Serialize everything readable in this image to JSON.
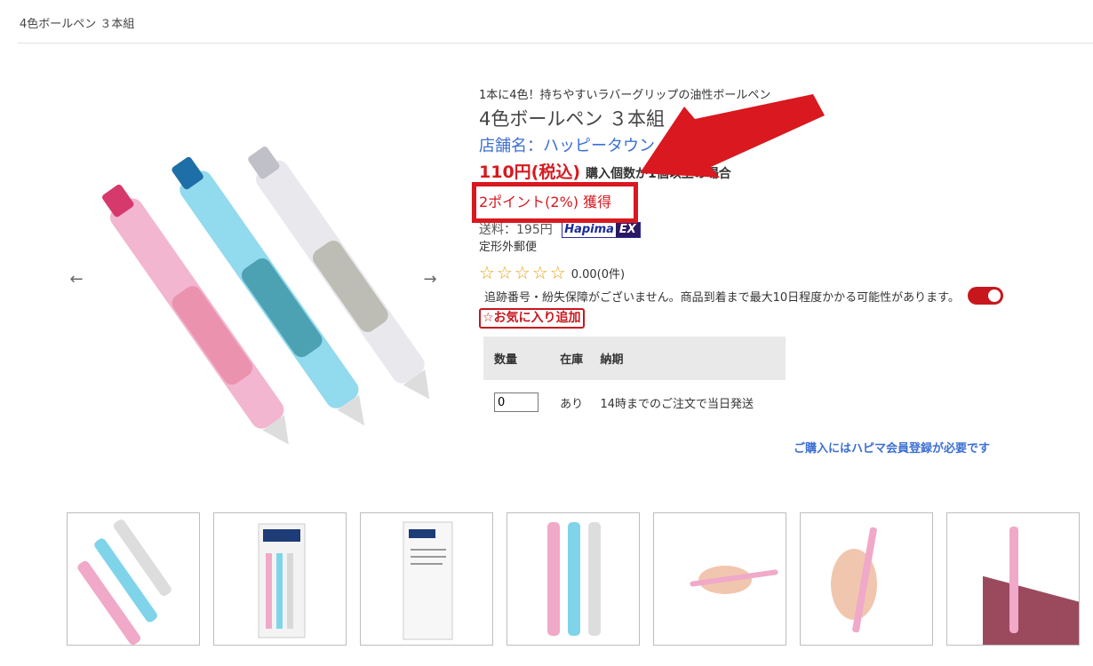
{
  "breadcrumb": "4色ボールペン ３本組",
  "product": {
    "subtitle": "1本に4色！持ちやすいラバーグリップの油性ボールペン",
    "title": "4色ボールペン ３本組",
    "shop": "店舗名：ハッピータウン",
    "price": "110円(税込)",
    "price_note": "購入個数が1個以上の場合",
    "points": "2ポイント(2%) 獲得",
    "shipping": "送料：195円",
    "shipping_method": "定形外郵便",
    "rating": "0.00(0件)",
    "notice": "追跡番号・紛失保障がございません。商品到着まで最大10日程度かかる可能性があります。",
    "favorite": "☆お気に入り追加"
  },
  "logo": {
    "hapima": "Hapima",
    "ex": "EX"
  },
  "stock_table": {
    "headers": [
      "数量",
      "在庫",
      "納期"
    ],
    "row": {
      "quantity": "0",
      "stock": "あり",
      "delivery": "14時までのご注文で当日発送"
    }
  },
  "register_link": "ご購入にはハピマ会員登録が必要です",
  "carousel": {
    "prev": "←",
    "next": "→"
  },
  "icons": {
    "star": "star-outline-icon",
    "arrow_prev": "arrow-left-icon",
    "arrow_next": "arrow-right-icon"
  },
  "colors": {
    "accent_red": "#d71920",
    "link_blue": "#3c6fd1",
    "annotation_red": "#d9181f"
  }
}
